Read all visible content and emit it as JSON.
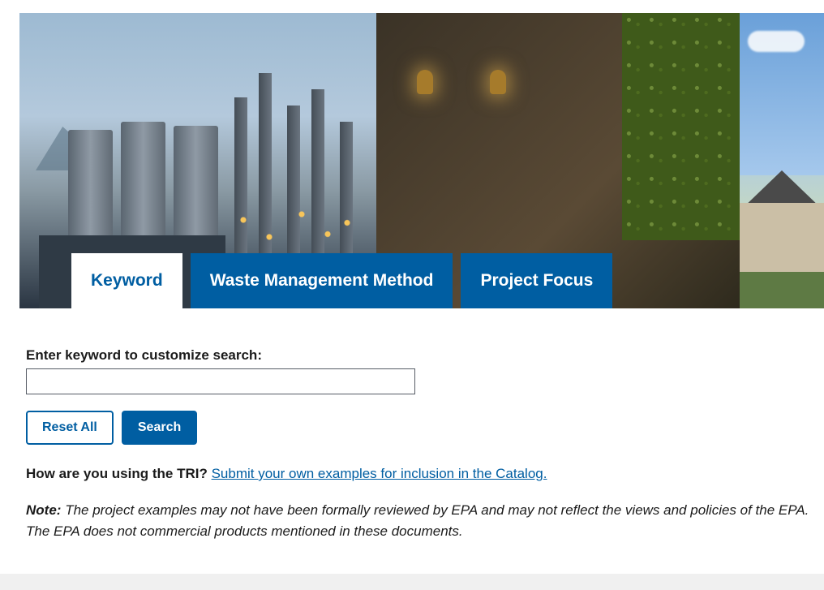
{
  "tabs": [
    {
      "label": "Keyword",
      "active": true
    },
    {
      "label": "Waste Management Method",
      "active": false
    },
    {
      "label": "Project Focus",
      "active": false
    }
  ],
  "form": {
    "keyword_label": "Enter keyword to customize search:",
    "keyword_value": "",
    "reset_label": "Reset All",
    "search_label": "Search"
  },
  "prompt": {
    "lead": "How are you using the TRI?",
    "link_text": "Submit your own examples for inclusion in the Catalog."
  },
  "note": {
    "label": "Note:",
    "body": "The project examples may not have been formally reviewed by EPA and may not reflect the views and policies of the EPA. The EPA does not commercial products mentioned in these documents."
  }
}
